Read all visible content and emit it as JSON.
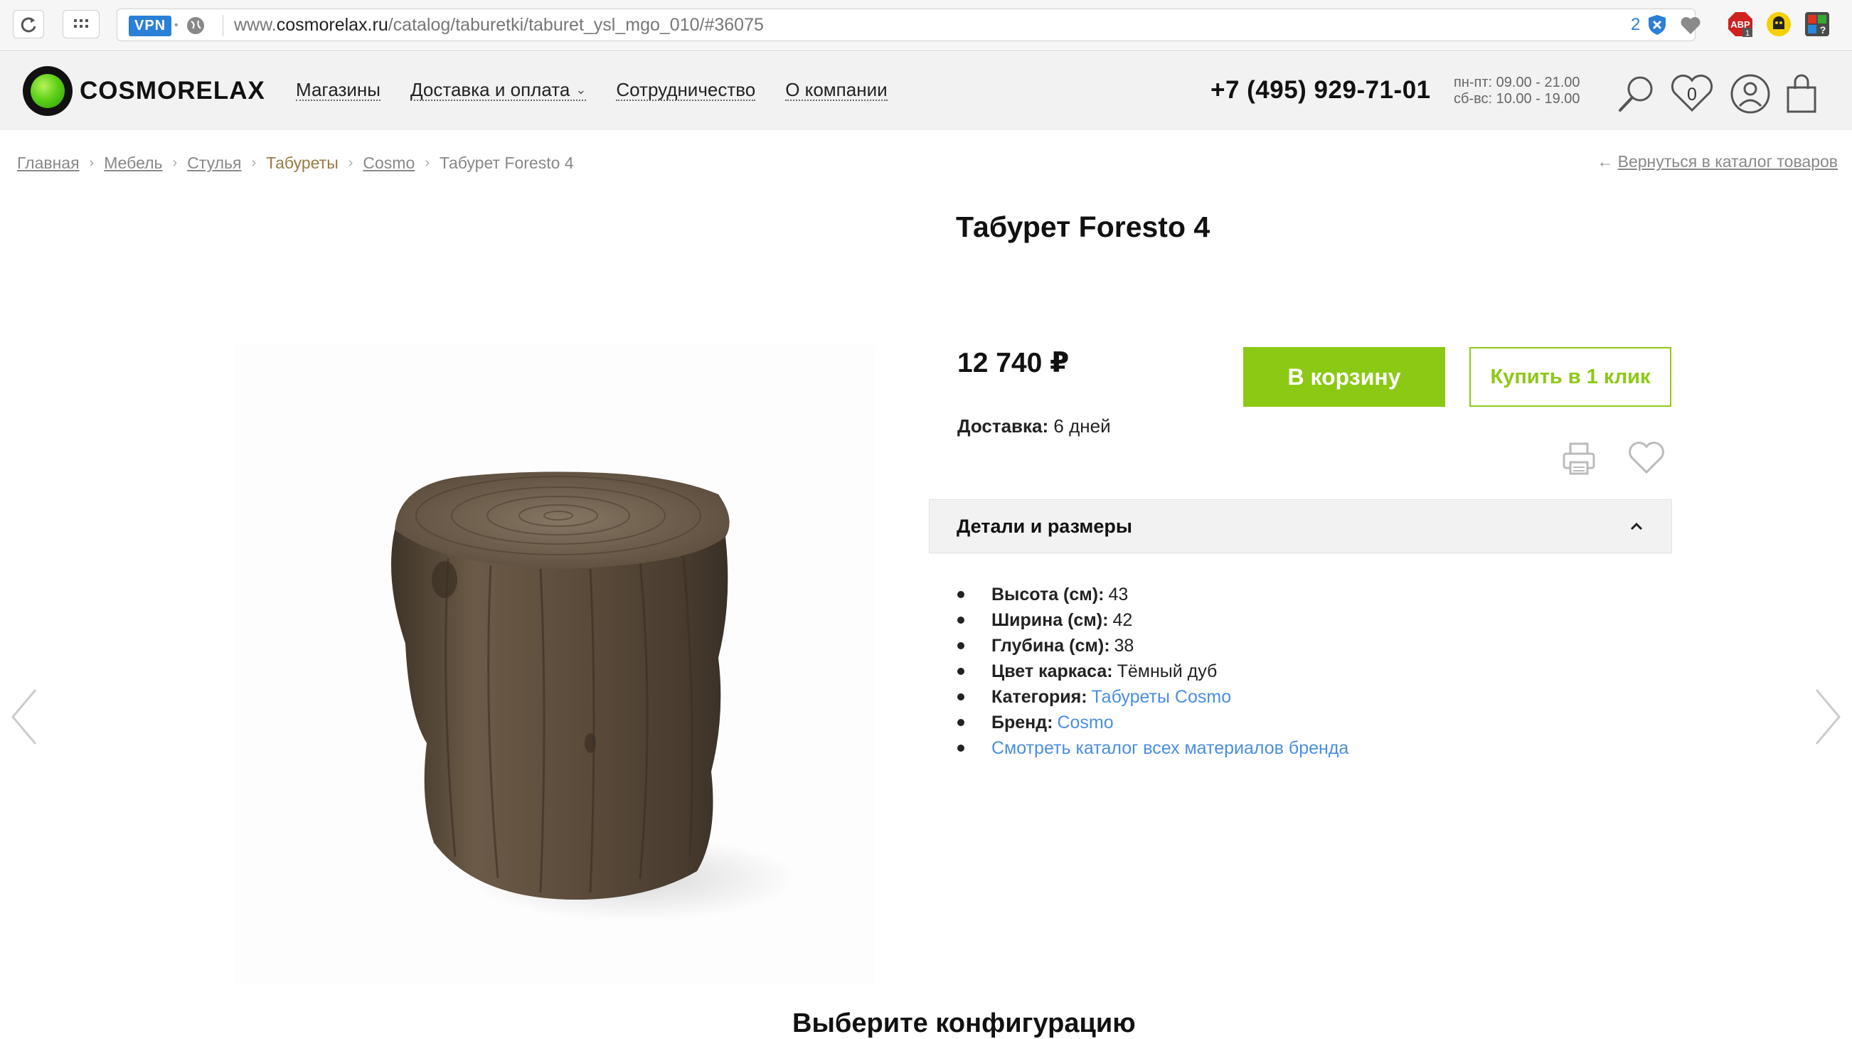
{
  "browser": {
    "vpn_label": "VPN",
    "url_prefix": "www.",
    "url_domain": "cosmorelax.ru",
    "url_path": "/catalog/taburetki/taburet_ysl_mgo_010/#36075",
    "extension_count": "2"
  },
  "header": {
    "logo_text": "COSMORELAX",
    "nav": [
      {
        "label": "Магазины"
      },
      {
        "label": "Доставка и оплата"
      },
      {
        "label": "Сотрудничество"
      },
      {
        "label": "О компании"
      }
    ],
    "phone": "+7 (495) 929-71-01",
    "hours_weekdays": "пн-пт: 09.00 - 21.00",
    "hours_weekend": "сб-вс: 10.00 - 19.00",
    "wishlist_count": "0"
  },
  "breadcrumbs": [
    "Главная",
    "Мебель",
    "Стулья",
    "Табуреты",
    "Cosmo",
    "Табурет Foresto 4"
  ],
  "back_link": "Вернуться в каталог товаров",
  "product": {
    "title": "Табурет Foresto 4",
    "price": "12 740 ₽",
    "delivery_label": "Доставка:",
    "delivery_value": "6 дней",
    "cart_button": "В корзину",
    "one_click_button": "Купить в 1 клик",
    "details_title": "Детали и размеры",
    "specs": [
      {
        "label": "Высота (см):",
        "value": "43"
      },
      {
        "label": "Ширина (см):",
        "value": "42"
      },
      {
        "label": "Глубина (см):",
        "value": "38"
      },
      {
        "label": "Цвет каркаса:",
        "value": "Тёмный дуб"
      },
      {
        "label": "Категория:",
        "value": "Табуреты Cosmo"
      },
      {
        "label": "Бренд:",
        "value": "Cosmo"
      }
    ],
    "catalog_link": "Смотреть каталог всех материалов бренда",
    "config_title": "Выберите конфигурацию"
  },
  "colors": {
    "accent_green": "#8cc914",
    "link_blue": "#4a8ee0",
    "breadcrumb_active": "#9a7a44"
  }
}
